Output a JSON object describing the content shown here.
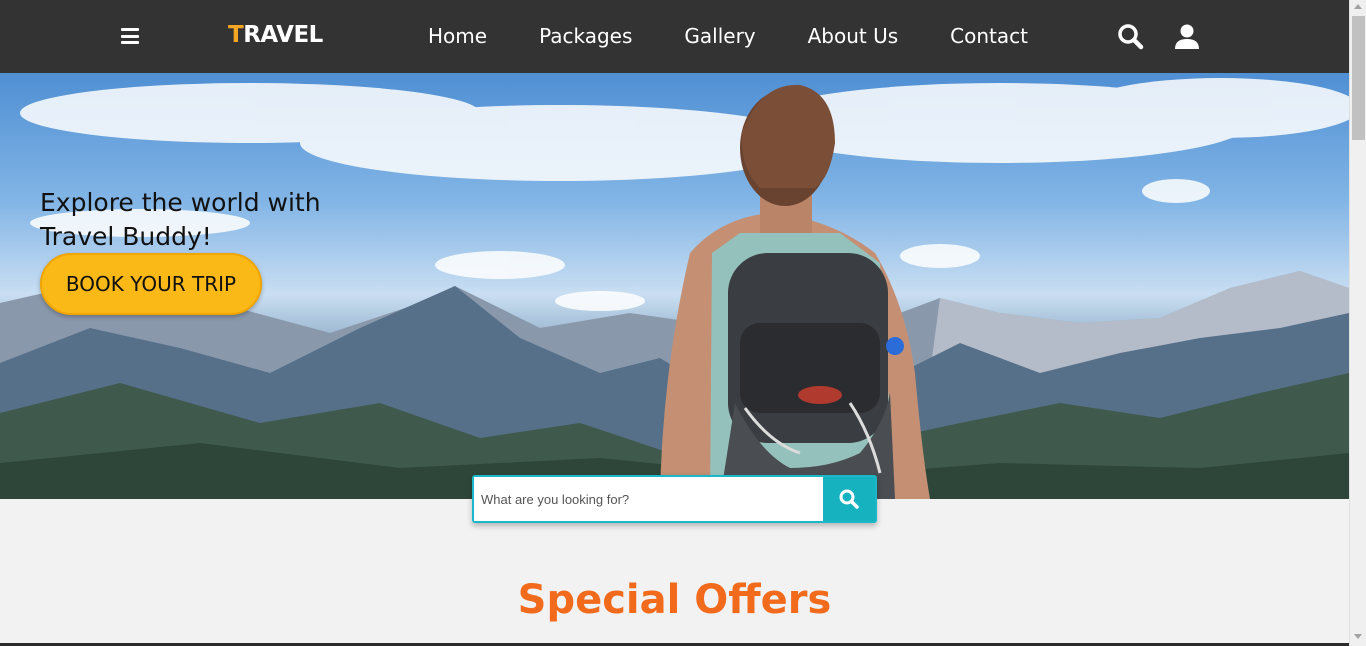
{
  "navbar": {
    "menu_icon": "hamburger-menu-icon",
    "logo_first_letter": "T",
    "logo_rest": "RAVEL",
    "logo_accent_color": "#f5a623",
    "background_color": "#333333",
    "links": [
      {
        "label": "Home"
      },
      {
        "label": "Packages"
      },
      {
        "label": "Gallery"
      },
      {
        "label": "About Us"
      },
      {
        "label": "Contact"
      }
    ],
    "search_icon": "search-icon",
    "user_icon": "user-icon"
  },
  "hero": {
    "title_line1": "Explore the world with",
    "title_line2": "Travel Buddy!",
    "cta_label": "BOOK YOUR TRIP",
    "cta_color": "#fbb917",
    "image_subject": "hiker-with-backpack-facing-mountains"
  },
  "search": {
    "placeholder": "What are you looking for?",
    "button_icon": "search-icon",
    "accent_color": "#17b2c0"
  },
  "section": {
    "title": "Special Offers",
    "title_color": "#f26a1b"
  }
}
